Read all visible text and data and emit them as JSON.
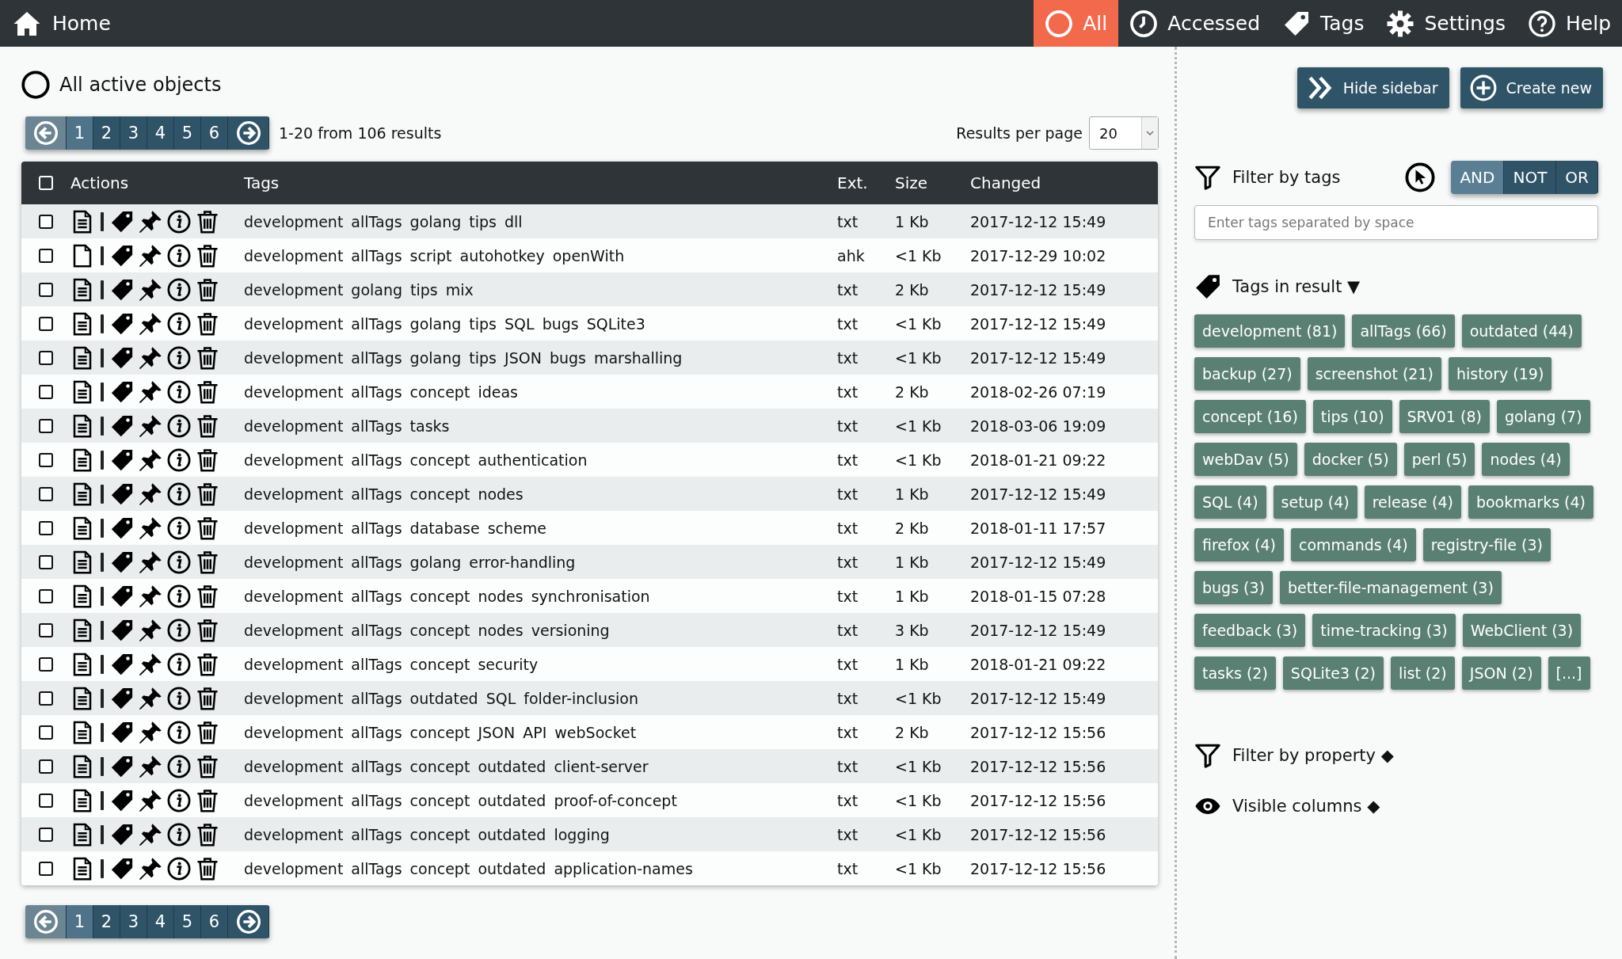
{
  "nav": {
    "home": "Home",
    "items": [
      {
        "kind": "circle",
        "label": "All",
        "selected": true
      },
      {
        "kind": "clock",
        "label": "Accessed",
        "selected": false
      },
      {
        "kind": "tag",
        "label": "Tags",
        "selected": false
      },
      {
        "kind": "gear",
        "label": "Settings",
        "selected": false
      },
      {
        "kind": "help",
        "label": "Help",
        "selected": false
      }
    ]
  },
  "page_title": "All active objects",
  "pagination_top": {
    "prev_disabled": true,
    "next_disabled": false,
    "pages": [
      {
        "label": "1",
        "selected": true
      },
      {
        "label": "2",
        "selected": false
      },
      {
        "label": "3",
        "selected": false
      },
      {
        "label": "4",
        "selected": false
      },
      {
        "label": "5",
        "selected": false
      },
      {
        "label": "6",
        "selected": false
      }
    ]
  },
  "result_summary": "1-20 from 106 results",
  "per_page": {
    "label": "Results per page",
    "value": "20"
  },
  "table": {
    "select_all_checked": false,
    "columns": [
      "Actions",
      "Tags",
      "Ext.",
      "Size",
      "Changed"
    ],
    "rows": [
      {
        "checked": false,
        "has_content": true,
        "tags": [
          "development",
          "allTags",
          "golang",
          "tips",
          "dll"
        ],
        "ext": "txt",
        "size": "1 Kb",
        "changed": "2017-12-12 15:49"
      },
      {
        "checked": false,
        "has_content": false,
        "tags": [
          "development",
          "allTags",
          "script",
          "autohotkey",
          "openWith"
        ],
        "ext": "ahk",
        "size": "<1 Kb",
        "changed": "2017-12-29 10:02"
      },
      {
        "checked": false,
        "has_content": true,
        "tags": [
          "development",
          "golang",
          "tips",
          "mix"
        ],
        "ext": "txt",
        "size": "2 Kb",
        "changed": "2017-12-12 15:49"
      },
      {
        "checked": false,
        "has_content": true,
        "tags": [
          "development",
          "allTags",
          "golang",
          "tips",
          "SQL",
          "bugs",
          "SQLite3"
        ],
        "ext": "txt",
        "size": "<1 Kb",
        "changed": "2017-12-12 15:49"
      },
      {
        "checked": false,
        "has_content": true,
        "tags": [
          "development",
          "allTags",
          "golang",
          "tips",
          "JSON",
          "bugs",
          "marshalling"
        ],
        "ext": "txt",
        "size": "<1 Kb",
        "changed": "2017-12-12 15:49"
      },
      {
        "checked": false,
        "has_content": true,
        "tags": [
          "development",
          "allTags",
          "concept",
          "ideas"
        ],
        "ext": "txt",
        "size": "2 Kb",
        "changed": "2018-02-26 07:19"
      },
      {
        "checked": false,
        "has_content": true,
        "tags": [
          "development",
          "allTags",
          "tasks"
        ],
        "ext": "txt",
        "size": "<1 Kb",
        "changed": "2018-03-06 19:09"
      },
      {
        "checked": false,
        "has_content": true,
        "tags": [
          "development",
          "allTags",
          "concept",
          "authentication"
        ],
        "ext": "txt",
        "size": "<1 Kb",
        "changed": "2018-01-21 09:22"
      },
      {
        "checked": false,
        "has_content": true,
        "tags": [
          "development",
          "allTags",
          "concept",
          "nodes"
        ],
        "ext": "txt",
        "size": "1 Kb",
        "changed": "2017-12-12 15:49"
      },
      {
        "checked": false,
        "has_content": true,
        "tags": [
          "development",
          "allTags",
          "database",
          "scheme"
        ],
        "ext": "txt",
        "size": "2 Kb",
        "changed": "2018-01-11 17:57"
      },
      {
        "checked": false,
        "has_content": true,
        "tags": [
          "development",
          "allTags",
          "golang",
          "error-handling"
        ],
        "ext": "txt",
        "size": "1 Kb",
        "changed": "2017-12-12 15:49"
      },
      {
        "checked": false,
        "has_content": true,
        "tags": [
          "development",
          "allTags",
          "concept",
          "nodes",
          "synchronisation"
        ],
        "ext": "txt",
        "size": "1 Kb",
        "changed": "2018-01-15 07:28"
      },
      {
        "checked": false,
        "has_content": true,
        "tags": [
          "development",
          "allTags",
          "concept",
          "nodes",
          "versioning"
        ],
        "ext": "txt",
        "size": "3 Kb",
        "changed": "2017-12-12 15:49"
      },
      {
        "checked": false,
        "has_content": true,
        "tags": [
          "development",
          "allTags",
          "concept",
          "security"
        ],
        "ext": "txt",
        "size": "1 Kb",
        "changed": "2018-01-21 09:22"
      },
      {
        "checked": false,
        "has_content": true,
        "tags": [
          "development",
          "allTags",
          "outdated",
          "SQL",
          "folder-inclusion"
        ],
        "ext": "txt",
        "size": "<1 Kb",
        "changed": "2017-12-12 15:49"
      },
      {
        "checked": false,
        "has_content": true,
        "tags": [
          "development",
          "allTags",
          "concept",
          "JSON",
          "API",
          "webSocket"
        ],
        "ext": "txt",
        "size": "2 Kb",
        "changed": "2017-12-12 15:56"
      },
      {
        "checked": false,
        "has_content": true,
        "tags": [
          "development",
          "allTags",
          "concept",
          "outdated",
          "client-server"
        ],
        "ext": "txt",
        "size": "<1 Kb",
        "changed": "2017-12-12 15:56"
      },
      {
        "checked": false,
        "has_content": true,
        "tags": [
          "development",
          "allTags",
          "concept",
          "outdated",
          "proof-of-concept"
        ],
        "ext": "txt",
        "size": "<1 Kb",
        "changed": "2017-12-12 15:56"
      },
      {
        "checked": false,
        "has_content": true,
        "tags": [
          "development",
          "allTags",
          "concept",
          "outdated",
          "logging"
        ],
        "ext": "txt",
        "size": "<1 Kb",
        "changed": "2017-12-12 15:56"
      },
      {
        "checked": false,
        "has_content": true,
        "tags": [
          "development",
          "allTags",
          "concept",
          "outdated",
          "application-names"
        ],
        "ext": "txt",
        "size": "<1 Kb",
        "changed": "2017-12-12 15:56"
      }
    ]
  },
  "pagination_bottom": {
    "prev_disabled": true,
    "next_disabled": false,
    "pages": [
      {
        "label": "1",
        "selected": true
      },
      {
        "label": "2",
        "selected": false
      },
      {
        "label": "3",
        "selected": false
      },
      {
        "label": "4",
        "selected": false
      },
      {
        "label": "5",
        "selected": false
      },
      {
        "label": "6",
        "selected": false
      }
    ]
  },
  "sidebar": {
    "hide_button": "Hide sidebar",
    "create_button": "Create new",
    "filter_tags": {
      "title": "Filter by tags",
      "modes": [
        {
          "label": "AND",
          "selected": true
        },
        {
          "label": "NOT",
          "selected": false
        },
        {
          "label": "OR",
          "selected": false
        }
      ],
      "placeholder": "Enter tags separated by space"
    },
    "tags_in_result": {
      "title": "Tags in result ▼",
      "tags": [
        "development (81)",
        "allTags (66)",
        "outdated (44)",
        "backup (27)",
        "screenshot (21)",
        "history (19)",
        "concept (16)",
        "tips (10)",
        "SRV01 (8)",
        "golang (7)",
        "webDav (5)",
        "docker (5)",
        "perl (5)",
        "nodes (4)",
        "SQL (4)",
        "setup (4)",
        "release (4)",
        "bookmarks (4)",
        "firefox (4)",
        "commands (4)",
        "registry-file (3)",
        "bugs (3)",
        "better-file-management (3)",
        "feedback (3)",
        "time-tracking (3)",
        "WebClient (3)",
        "tasks (2)",
        "SQLite3 (2)",
        "list (2)",
        "JSON (2)",
        "[...]"
      ]
    },
    "filter_property": "Filter by property ◆",
    "visible_columns": "Visible columns ◆"
  }
}
